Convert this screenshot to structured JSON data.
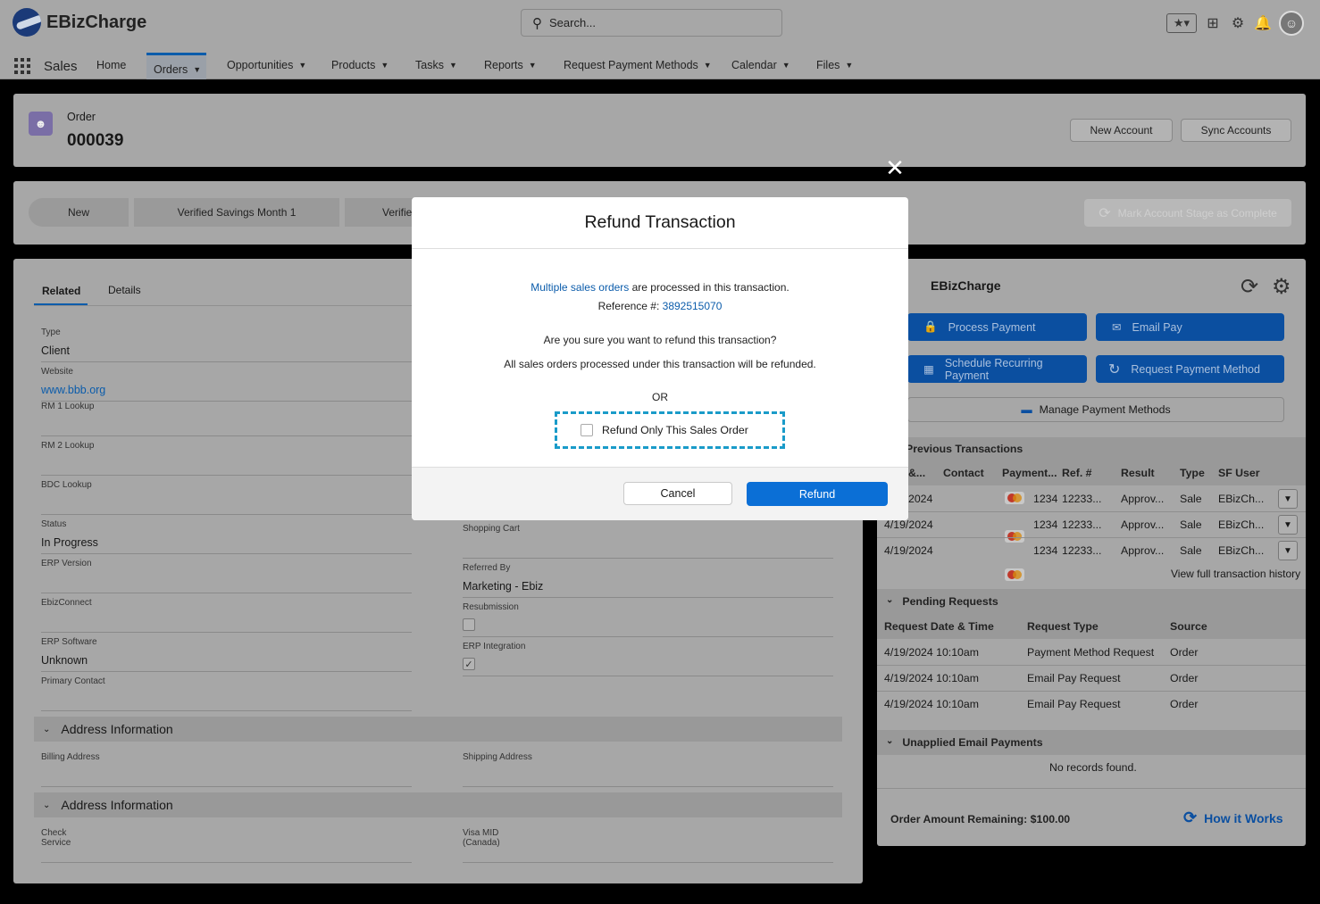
{
  "header": {
    "brand": "EBizCharge",
    "search_placeholder": "Search..."
  },
  "nav": {
    "app_name": "Sales",
    "items": [
      {
        "label": "Home"
      },
      {
        "label": "Orders"
      },
      {
        "label": "Opportunities"
      },
      {
        "label": "Products"
      },
      {
        "label": "Tasks"
      },
      {
        "label": "Reports"
      },
      {
        "label": "Request Payment Methods"
      },
      {
        "label": "Calendar"
      },
      {
        "label": "Files"
      }
    ]
  },
  "record": {
    "type": "Order",
    "number": "000039",
    "buttons": {
      "new_account": "New Account",
      "sync_accounts": "Sync Accounts"
    }
  },
  "path": {
    "steps": [
      "New",
      "Verified Savings Month 1",
      "Verifie"
    ],
    "mark_complete": "Mark Account Stage as Complete"
  },
  "tabs": {
    "related": "Related",
    "details": "Details"
  },
  "fields": {
    "type_label": "Type",
    "type_value": "Client",
    "website_label": "Website",
    "website_value": "www.bbb.org",
    "rm1_label": "RM 1 Lookup",
    "rm2_label": "RM 2 Lookup",
    "bdc_label": "BDC Lookup",
    "status_label": "Status",
    "status_value": "In Progress",
    "erp_version_label": "ERP Version",
    "ebizconnect_label": "EbizConnect",
    "erp_software_label": "ERP Software",
    "erp_software_value": "Unknown",
    "primary_contact_label": "Primary Contact",
    "shopping_cart_label": "Shopping Cart",
    "referred_by_label": "Referred By",
    "referred_by_value": "Marketing - Ebiz",
    "resubmission_label": "Resubmission",
    "erp_integration_label": "ERP Integration",
    "section1": "Address Information",
    "billing_label": "Billing Address",
    "shipping_label": "Shipping Address",
    "section2": "Address Information",
    "check_label": "Check\nService",
    "visa_label": "Visa MID\n(Canada)"
  },
  "ebiz": {
    "title": "EBizCharge",
    "process_payment": "Process Payment",
    "email_pay": "Email Pay",
    "schedule_recurring": "Schedule Recurring Payment",
    "request_payment_method": "Request Payment Method",
    "manage_methods": "Manage Payment Methods",
    "prev_title": "Previous Transactions",
    "prev_headers": [
      "&...",
      "Contact",
      "Payment...",
      "Ref. #",
      "Result",
      "Type",
      "SF User"
    ],
    "prev_rows": [
      {
        "date": "2024",
        "card": "1234",
        "ref": "12233...",
        "result": "Approv...",
        "type": "Sale",
        "user": "EBizCh..."
      },
      {
        "date": "4/19/2024",
        "card": "1234",
        "ref": "12233...",
        "result": "Approv...",
        "type": "Sale",
        "user": "EBizCh..."
      },
      {
        "date": "4/19/2024",
        "card": "1234",
        "ref": "12233...",
        "result": "Approv...",
        "type": "Sale",
        "user": "EBizCh..."
      }
    ],
    "view_history": "View full transaction history",
    "pending_title": "Pending Requests",
    "pending_headers": [
      "Request Date & Time",
      "Request Type",
      "Source"
    ],
    "pending_rows": [
      {
        "date": "4/19/2024 10:10am",
        "type": "Payment Method Request",
        "source": "Order"
      },
      {
        "date": "4/19/2024 10:10am",
        "type": "Email Pay Request",
        "source": "Order"
      },
      {
        "date": "4/19/2024 10:10am",
        "type": "Email Pay Request",
        "source": "Order"
      }
    ],
    "unapplied_title": "Unapplied Email Payments",
    "no_records": "No records found.",
    "order_remaining": "Order Amount Remaining: $100.00",
    "how_it_works": "How it Works"
  },
  "modal": {
    "title": "Refund Transaction",
    "link_text": "Multiple sales orders",
    "line1_rest": " are processed in this transaction.",
    "ref_label": "Reference #: ",
    "ref_value": "3892515070",
    "question": "Are you sure you want to refund this transaction?",
    "note": "All sales orders processed under this transaction will be refunded.",
    "or": "OR",
    "option": "Refund Only This Sales Order",
    "cancel": "Cancel",
    "refund": "Refund",
    "close": "✕"
  }
}
